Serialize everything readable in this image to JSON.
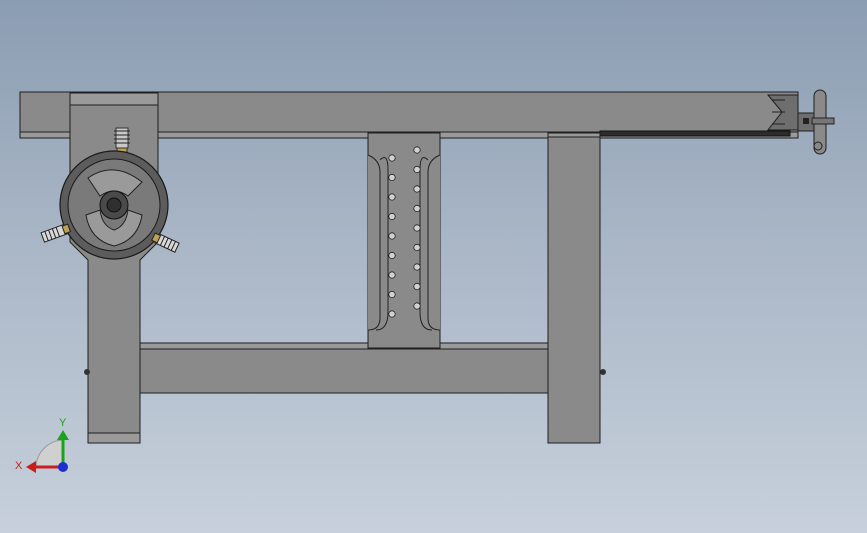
{
  "viewport": {
    "background_top": "#8b9db2",
    "background_bottom": "#c7d0dc"
  },
  "triad": {
    "x_label": "X",
    "y_label": "Y",
    "x_color": "#c81e1e",
    "y_color": "#1aa31a",
    "z_color": "#1e2fd0"
  },
  "icons": {
    "handwheel_left": "handwheel-icon",
    "handwheel_right": "handwheel-icon"
  }
}
